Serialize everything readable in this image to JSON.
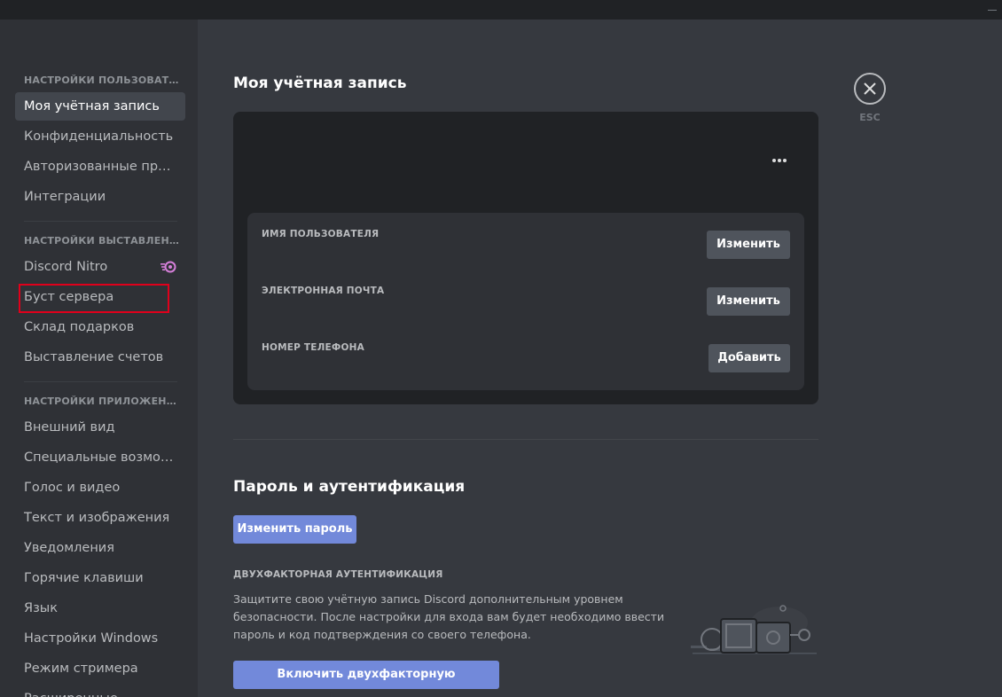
{
  "sidebar": {
    "sections": [
      {
        "header": "НАСТРОЙКИ ПОЛЬЗОВАТЕЛЯ",
        "items": [
          {
            "label": "Моя учётная запись",
            "active": true
          },
          {
            "label": "Конфиденциальность"
          },
          {
            "label": "Авторизованные приложения"
          },
          {
            "label": "Интеграции"
          }
        ]
      },
      {
        "header": "НАСТРОЙКИ ВЫСТАВЛЕНИЯ СЧЕТОВ",
        "items": [
          {
            "label": "Discord Nitro",
            "icon": "nitro-icon"
          },
          {
            "label": "Буст сервера",
            "highlighted": true
          },
          {
            "label": "Склад подарков"
          },
          {
            "label": "Выставление счетов"
          }
        ]
      },
      {
        "header": "НАСТРОЙКИ ПРИЛОЖЕНИЯ",
        "items": [
          {
            "label": "Внешний вид"
          },
          {
            "label": "Специальные возможности"
          },
          {
            "label": "Голос и видео"
          },
          {
            "label": "Текст и изображения"
          },
          {
            "label": "Уведомления"
          },
          {
            "label": "Горячие клавиши"
          },
          {
            "label": "Язык"
          },
          {
            "label": "Настройки Windows"
          },
          {
            "label": "Режим стримера"
          },
          {
            "label": "Расширенные"
          }
        ]
      }
    ]
  },
  "main": {
    "title": "Моя учётная запись",
    "account": {
      "fields": [
        {
          "label": "ИМЯ ПОЛЬЗОВАТЕЛЯ",
          "button": "Изменить"
        },
        {
          "label": "ЭЛЕКТРОННАЯ ПОЧТА",
          "button": "Изменить"
        },
        {
          "label": "НОМЕР ТЕЛЕФОНА",
          "button": "Добавить"
        }
      ]
    },
    "password_section": {
      "title": "Пароль и аутентификация",
      "change_password_button": "Изменить пароль",
      "twofa_label": "ДВУХФАКТОРНАЯ АУТЕНТИФИКАЦИЯ",
      "twofa_description": "Защитите свою учётную запись Discord дополнительным уровнем безопасности. После настройки для входа вам будет необходимо ввести пароль и код подтверждения со своего телефона.",
      "enable_twofa_button": "Включить двухфакторную аутентификацию"
    }
  },
  "close": {
    "label": "ESC",
    "icon": "close-icon"
  },
  "colors": {
    "background": "#36393f",
    "sidebar": "#2f3136",
    "card": "#202225",
    "accent": "#7289da",
    "highlight_box": "#e0001b"
  }
}
